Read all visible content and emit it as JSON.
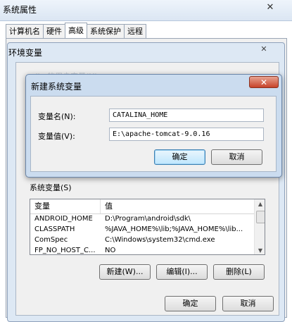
{
  "window": {
    "title": "系统属性",
    "close_glyph": "✕"
  },
  "tabs": [
    "计算机名",
    "硬件",
    "高级",
    "系统保护",
    "远程"
  ],
  "env_dialog": {
    "title": "环境变量",
    "close_glyph": "✕",
    "blurred_text": "...ii.. 的用户变量(U)"
  },
  "new_dialog": {
    "title": "新建系统变量",
    "close_glyph": "✕",
    "name_label": "变量名(N):",
    "name_value": "CATALINA_HOME",
    "value_label": "变量值(V):",
    "value_value": "E:\\apache-tomcat-9.0.16",
    "ok_label": "确定",
    "cancel_label": "取消"
  },
  "system_vars": {
    "label": "系统变量(S)",
    "columns": [
      "变量",
      "值"
    ],
    "rows": [
      {
        "name": "ANDROID_HOME",
        "value": "D:\\Program\\android\\sdk\\"
      },
      {
        "name": "CLASSPATH",
        "value": "%JAVA_HOME%\\lib;%JAVA_HOME%\\lib..."
      },
      {
        "name": "ComSpec",
        "value": "C:\\Windows\\system32\\cmd.exe"
      },
      {
        "name": "FP_NO_HOST_C...",
        "value": "NO"
      }
    ],
    "new_label": "新建(W)...",
    "edit_label": "编辑(I)...",
    "delete_label": "删除(L)"
  },
  "footer": {
    "ok_label": "确定",
    "cancel_label": "取消"
  }
}
